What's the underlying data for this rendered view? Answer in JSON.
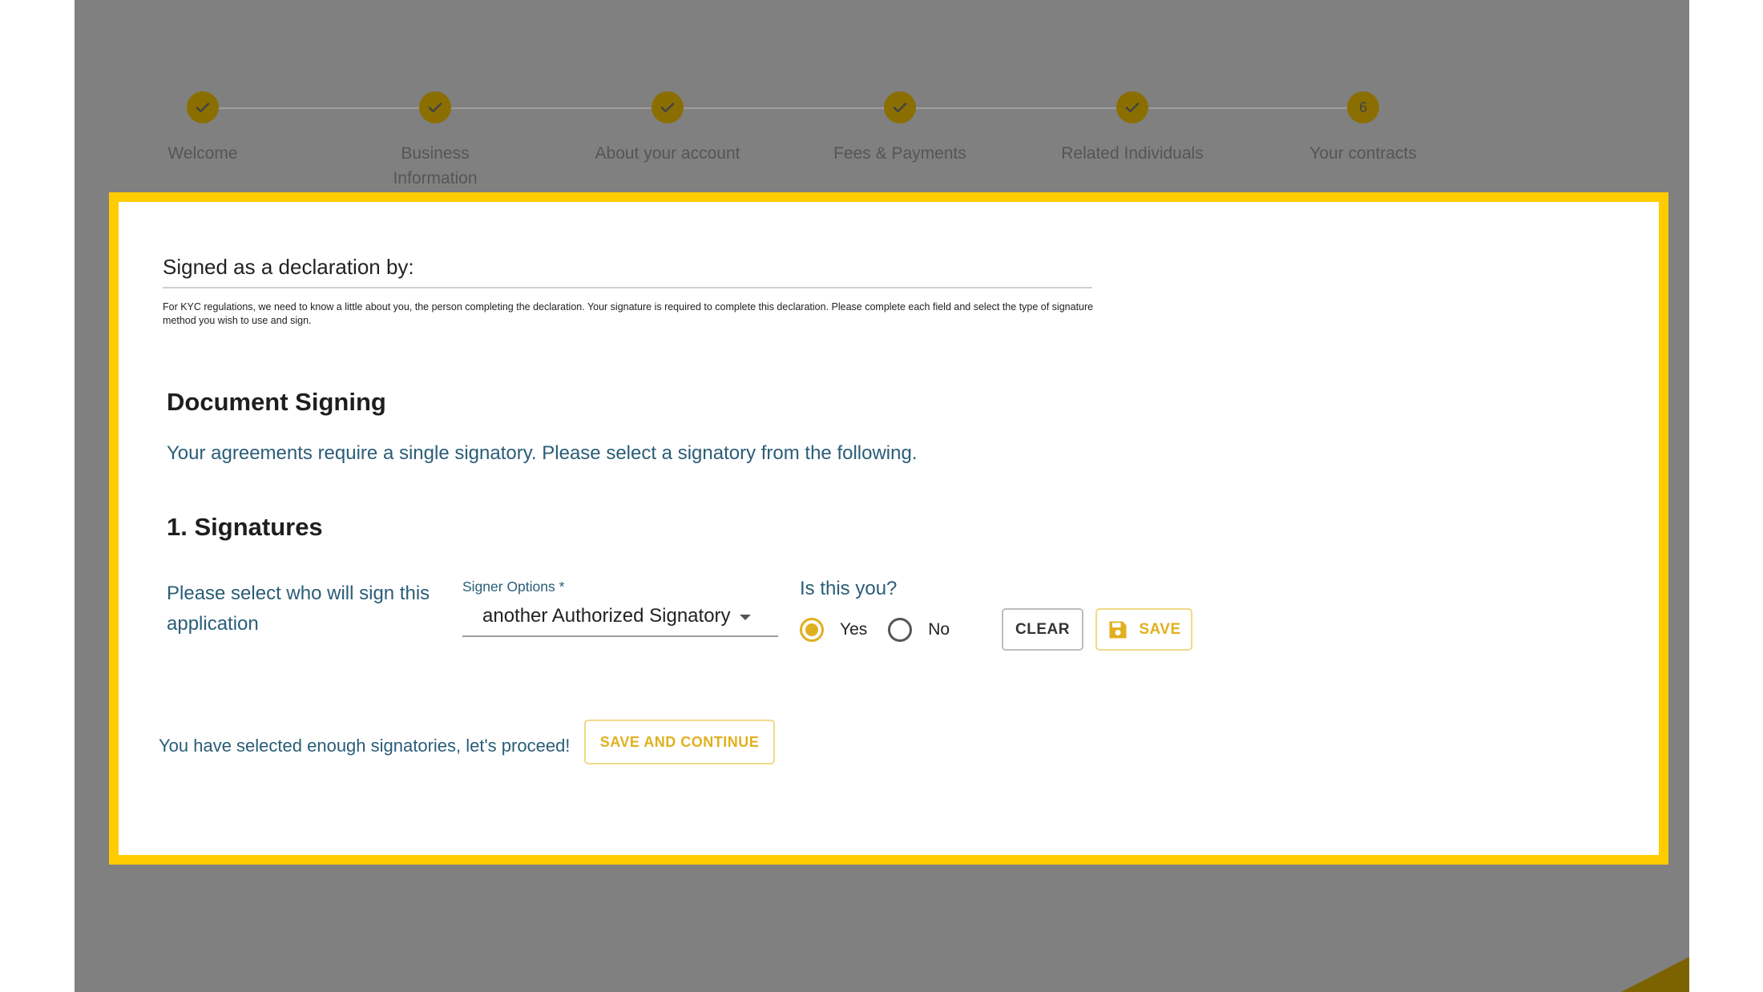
{
  "stepper": {
    "steps": [
      {
        "label": "Welcome",
        "status": "complete"
      },
      {
        "label": "Business Information",
        "status": "complete"
      },
      {
        "label": "About your account",
        "status": "complete"
      },
      {
        "label": "Fees & Payments",
        "status": "complete"
      },
      {
        "label": "Related Individuals",
        "status": "complete"
      },
      {
        "label": "Your contracts",
        "status": "current",
        "number": "6"
      }
    ]
  },
  "declaration": {
    "title": "Signed as a declaration by:",
    "note": "For KYC regulations, we need to know a little about you, the person completing the declaration. Your signature is required to complete this declaration. Please complete each field and select the type of signature method you wish to use and sign."
  },
  "document": {
    "title": "Document Signing",
    "subtitle": "Your agreements require a single signatory. Please select a signatory from the following."
  },
  "signatures": {
    "title": "1. Signatures",
    "prompt": "Please select who will sign this application",
    "signer_label": "Signer Options *",
    "signer_value": "another Authorized Signatory",
    "is_you_label": "Is this you?",
    "yes_label": "Yes",
    "no_label": "No",
    "selected": "yes",
    "clear_label": "CLEAR",
    "save_label": "SAVE"
  },
  "footer": {
    "proceed_text": "You have selected enough signatories, let's proceed!",
    "continue_label": "SAVE AND CONTINUE"
  },
  "colors": {
    "accent": "#e0b020",
    "highlight_border": "#ffcc00",
    "step_circle": "#8a6f00",
    "text_blue": "#2a5d78",
    "overlay": "#808080"
  }
}
